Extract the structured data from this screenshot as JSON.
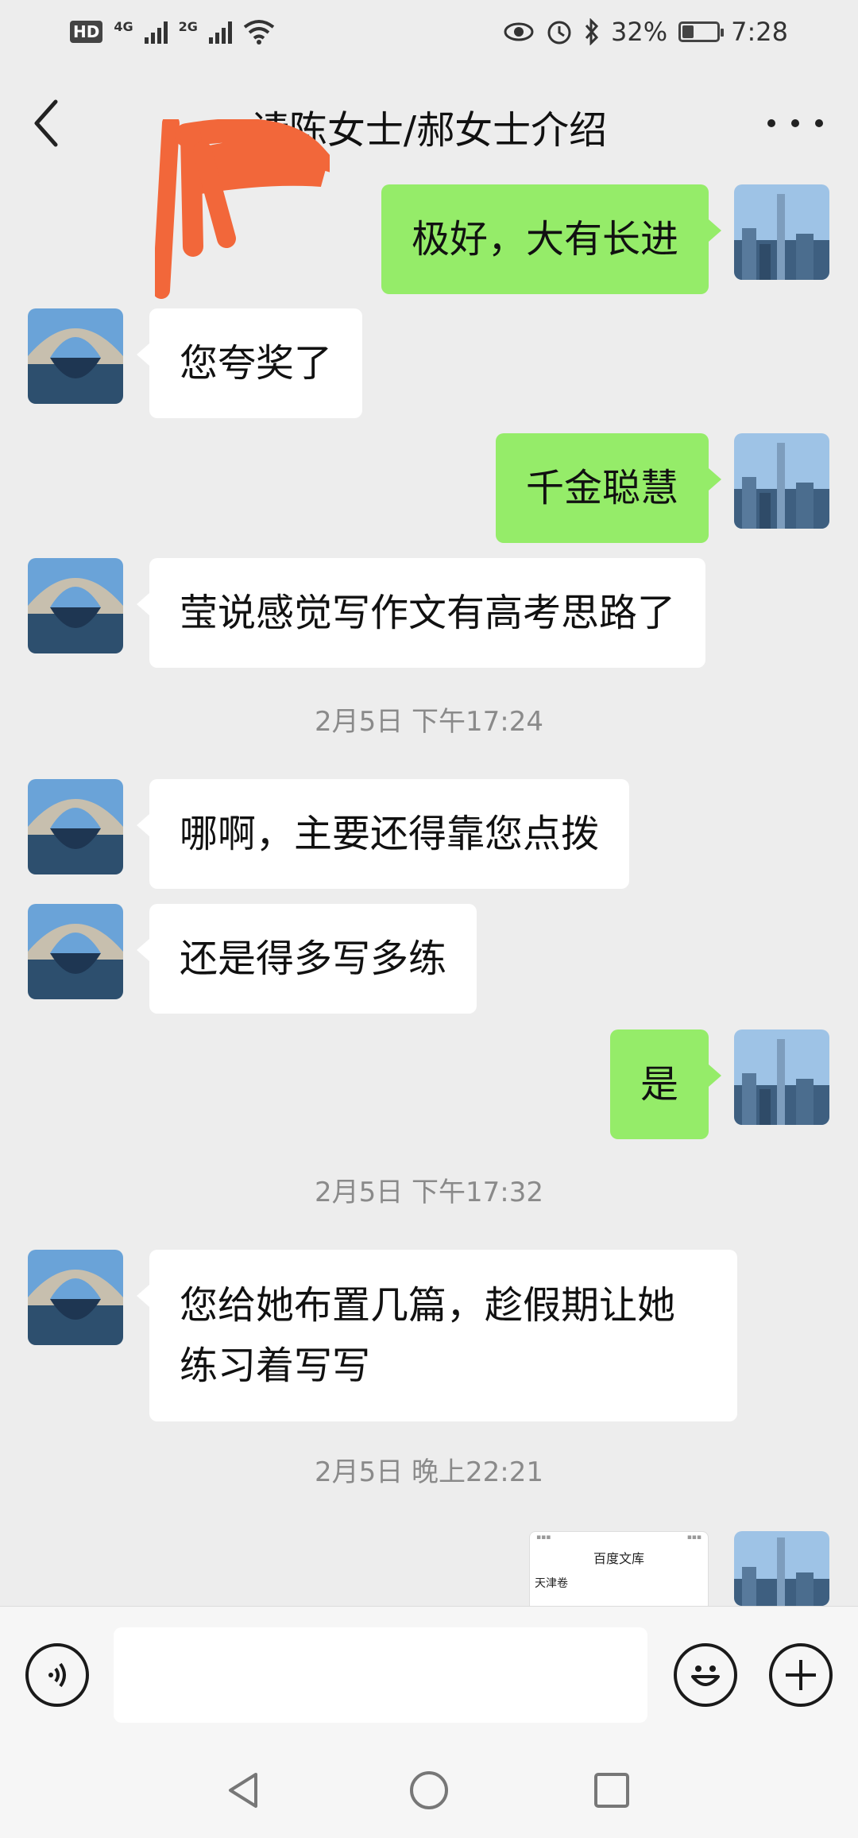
{
  "status_bar": {
    "hd": "HD",
    "network1": "4G",
    "network2": "2G",
    "battery": "32%",
    "battery_level": 0.32,
    "time": "7:28"
  },
  "header": {
    "title": "请陈女士/郝女士介绍"
  },
  "messages": [
    {
      "side": "right",
      "text": "极好，大有长进"
    },
    {
      "side": "left",
      "text": "您夸奖了"
    },
    {
      "side": "right",
      "text": "千金聪慧"
    },
    {
      "side": "left",
      "text": "莹说感觉写作文有高考思路了"
    },
    {
      "side": "left",
      "text": "哪啊，主要还得靠您点拨"
    },
    {
      "side": "left",
      "text": "还是得多写多练"
    },
    {
      "side": "right",
      "text": "是"
    },
    {
      "side": "left",
      "text": "您给她布置几篇，趁假期让她练习着写写"
    }
  ],
  "timestamps": [
    "2月5日 下午17:24",
    "2月5日 下午17:32",
    "2月5日 晚上22:21"
  ],
  "doc_preview": {
    "title": "百度文库",
    "subtitle": "天津卷"
  },
  "input": {
    "placeholder": ""
  },
  "colors": {
    "background": "#ededed",
    "sent_bubble": "#95ec69",
    "received_bubble": "#ffffff",
    "timestamp": "#8a8a8a"
  },
  "icons": {
    "back": "chevron-left-icon",
    "more": "more-dots-icon",
    "voice": "voice-icon",
    "emoji": "emoji-icon",
    "plus": "plus-icon"
  }
}
